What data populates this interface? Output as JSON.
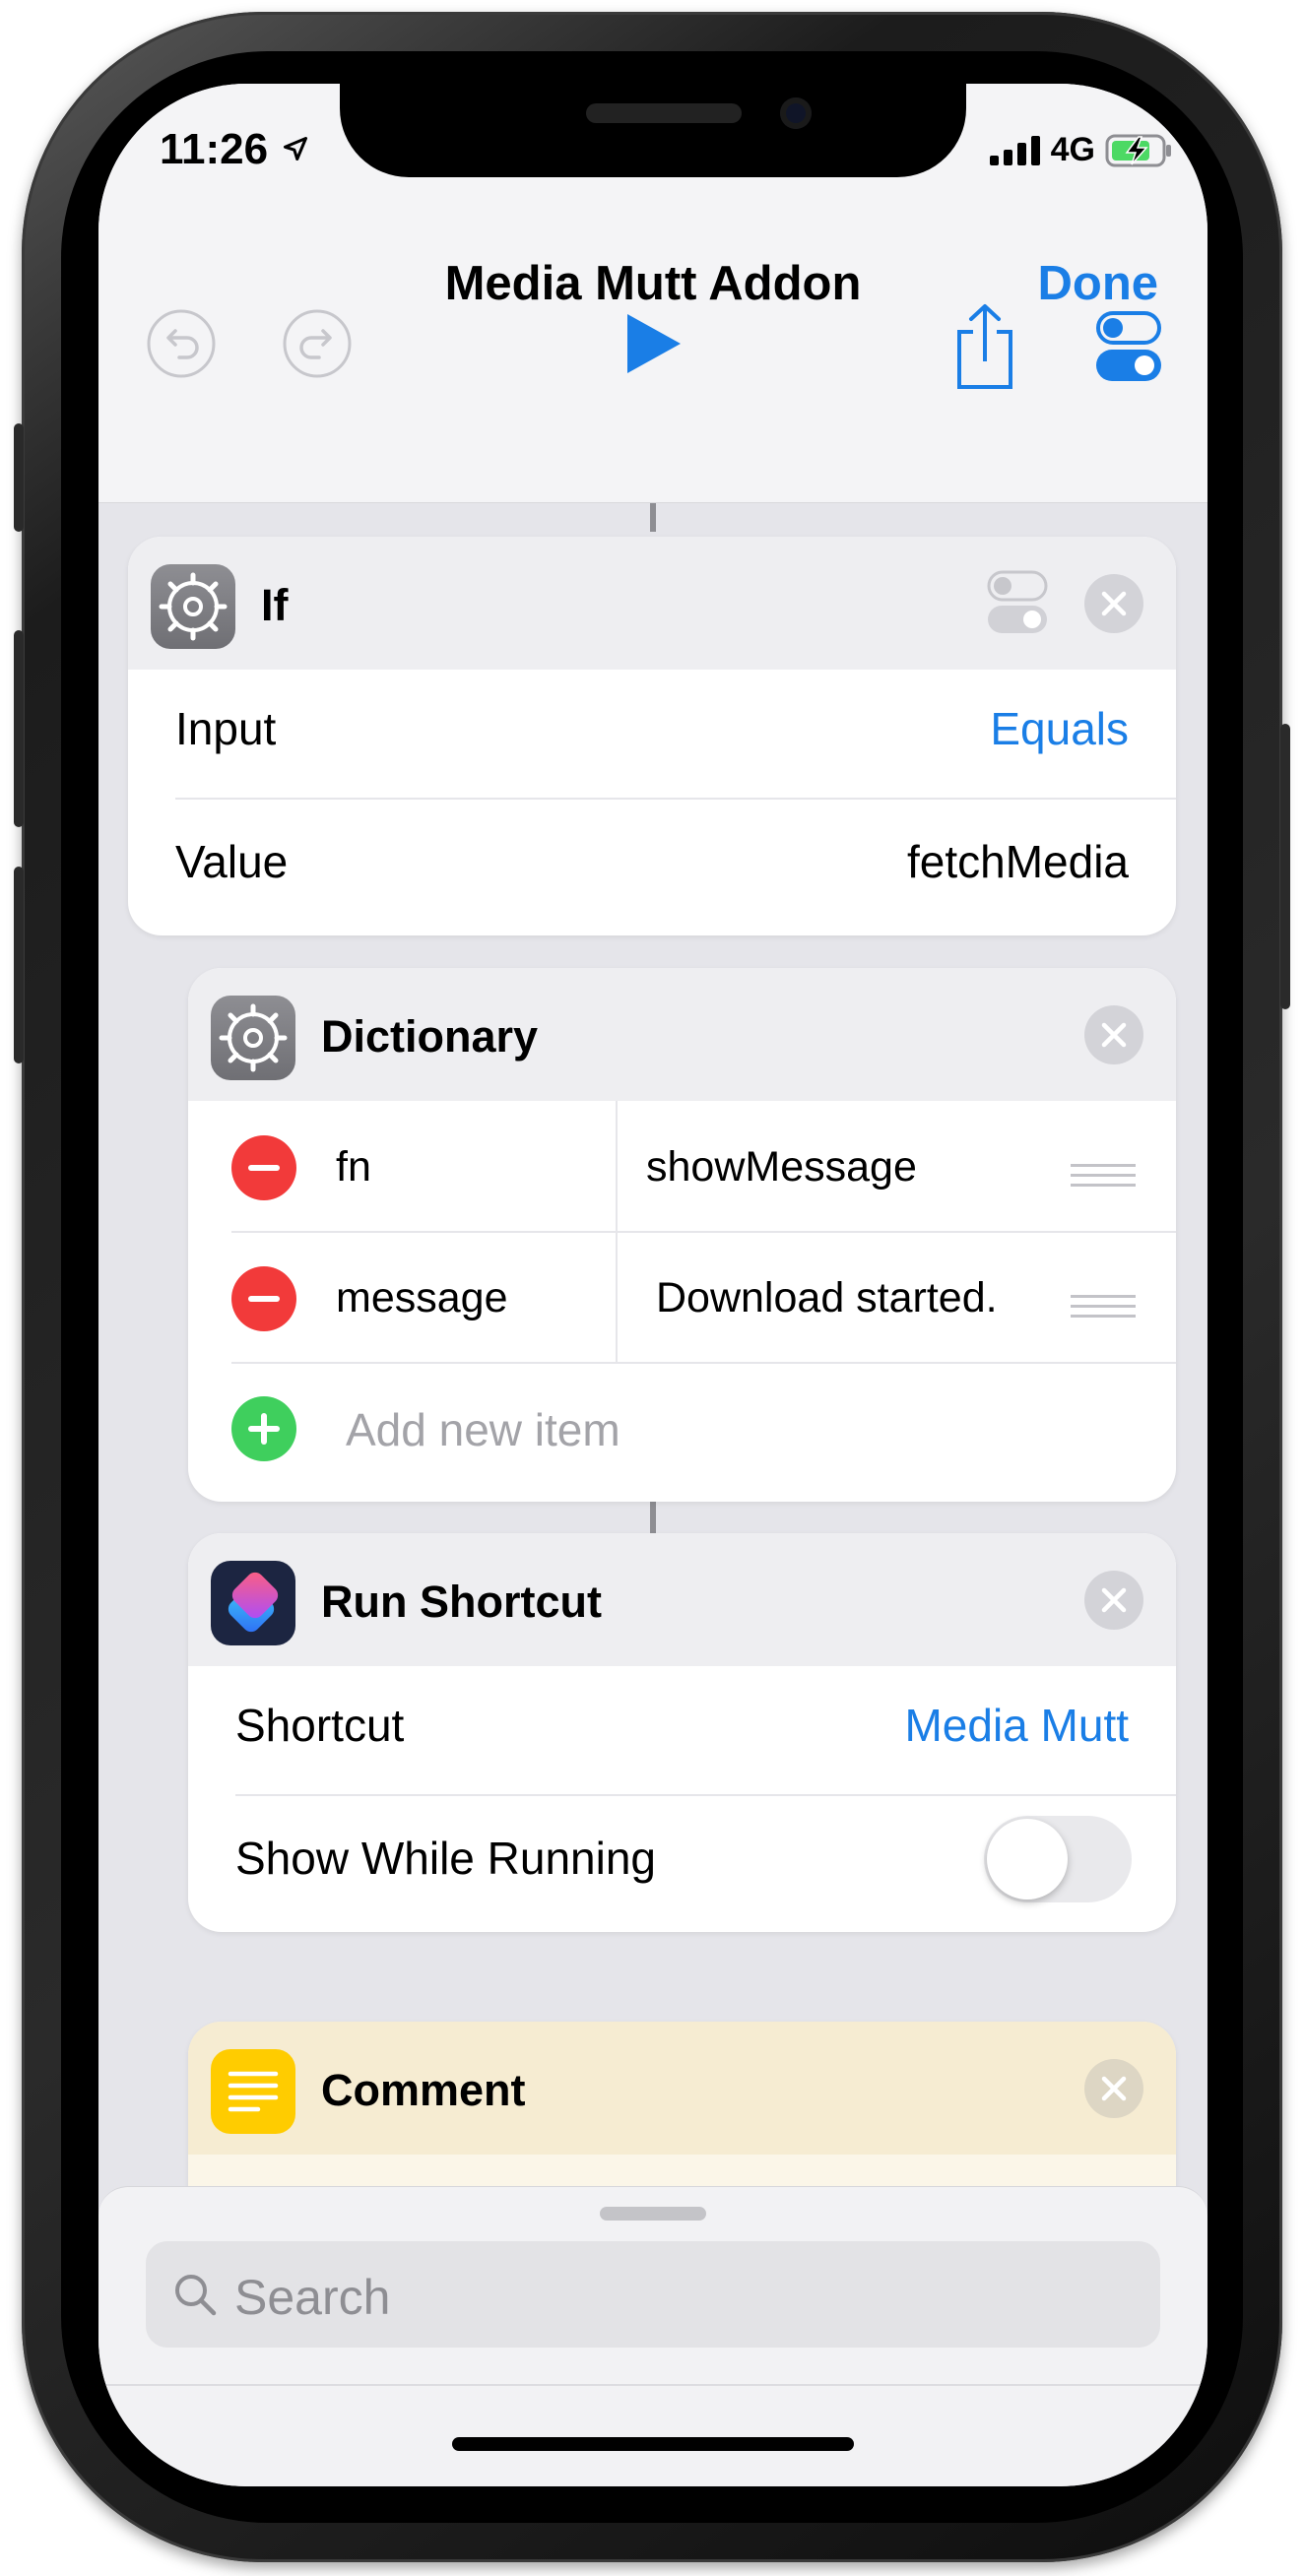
{
  "status_bar": {
    "time": "11:26",
    "network": "4G"
  },
  "nav": {
    "title": "Media Mutt Addon",
    "done_label": "Done"
  },
  "if_card": {
    "title": "If",
    "rows": [
      {
        "label": "Input",
        "value": "Equals"
      },
      {
        "label": "Value",
        "value": "fetchMedia"
      }
    ]
  },
  "dictionary_card": {
    "title": "Dictionary",
    "items": [
      {
        "key": "fn",
        "value": "showMessage"
      },
      {
        "key": "message",
        "value": "Download started."
      }
    ],
    "add_label": "Add new item"
  },
  "run_shortcut_card": {
    "title": "Run Shortcut",
    "shortcut_label": "Shortcut",
    "shortcut_value": "Media Mutt",
    "show_label": "Show While Running",
    "show_while_running": false
  },
  "comment_card": {
    "title": "Comment"
  },
  "search": {
    "placeholder": "Search"
  },
  "colors": {
    "accent": "#1a7ee6",
    "delete": "#f23a3a",
    "add": "#3fcf5d",
    "comment_yellow": "#ffcc00"
  }
}
